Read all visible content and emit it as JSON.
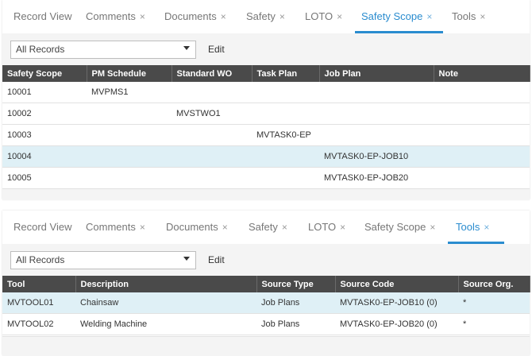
{
  "panel1": {
    "tabs": [
      {
        "label": "Record View",
        "closable": false,
        "active": false
      },
      {
        "label": "Comments",
        "closable": true,
        "active": false
      },
      {
        "label": "Documents",
        "closable": true,
        "active": false
      },
      {
        "label": "Safety",
        "closable": true,
        "active": false
      },
      {
        "label": "LOTO",
        "closable": true,
        "active": false
      },
      {
        "label": "Safety Scope",
        "closable": true,
        "active": true
      },
      {
        "label": "Tools",
        "closable": true,
        "active": false
      }
    ],
    "filter_value": "All Records",
    "edit_label": "Edit",
    "columns": [
      "Safety Scope",
      "PM Schedule",
      "Standard WO",
      "Task Plan",
      "Job Plan",
      "Note"
    ],
    "rows": [
      [
        "10001",
        "MVPMS1",
        "",
        "",
        "",
        ""
      ],
      [
        "10002",
        "",
        "MVSTWO1",
        "",
        "",
        ""
      ],
      [
        "10003",
        "",
        "",
        "MVTASK0-EP",
        "",
        ""
      ],
      [
        "10004",
        "",
        "",
        "",
        "MVTASK0-EP-JOB10",
        ""
      ],
      [
        "10005",
        "",
        "",
        "",
        "MVTASK0-EP-JOB20",
        ""
      ]
    ],
    "highlighted_row": 3
  },
  "panel2": {
    "tabs": [
      {
        "label": "Record View",
        "closable": false,
        "active": false
      },
      {
        "label": "Comments",
        "closable": true,
        "active": false
      },
      {
        "label": "Documents",
        "closable": true,
        "active": false
      },
      {
        "label": "Safety",
        "closable": true,
        "active": false
      },
      {
        "label": "LOTO",
        "closable": true,
        "active": false
      },
      {
        "label": "Safety Scope",
        "closable": true,
        "active": false
      },
      {
        "label": "Tools",
        "closable": true,
        "active": true
      }
    ],
    "filter_value": "All Records",
    "edit_label": "Edit",
    "columns": [
      "Tool",
      "Description",
      "Source Type",
      "Source Code",
      "Source Org."
    ],
    "rows": [
      [
        "MVTOOL01",
        "Chainsaw",
        "Job Plans",
        "MVTASK0-EP-JOB10 (0)",
        "*"
      ],
      [
        "MVTOOL02",
        "Welding Machine",
        "Job Plans",
        "MVTASK0-EP-JOB20 (0)",
        "*"
      ]
    ],
    "highlighted_row": 0
  },
  "close_glyph": "×",
  "colors": {
    "accent": "#2a8ccf",
    "header_bg": "#4a4a4a",
    "highlight_row": "#dff0f6",
    "toolbar_bg": "#f4f4f4"
  }
}
